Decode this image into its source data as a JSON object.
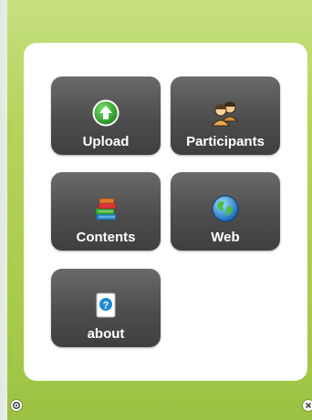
{
  "menu": {
    "tiles": [
      {
        "label": "Upload",
        "icon": "upload-arrow-icon"
      },
      {
        "label": "Participants",
        "icon": "participants-icon"
      },
      {
        "label": "Contents",
        "icon": "books-icon"
      },
      {
        "label": "Web",
        "icon": "globe-icon"
      },
      {
        "label": "about",
        "icon": "info-icon"
      }
    ]
  },
  "footer": {
    "left_icon": "gear-icon",
    "right_icon": "close-icon"
  },
  "colors": {
    "background_green": "#a9cc4c",
    "tile_dark": "#4d4d4d",
    "upload_green": "#2fa52a",
    "info_blue": "#1e8bd6"
  }
}
